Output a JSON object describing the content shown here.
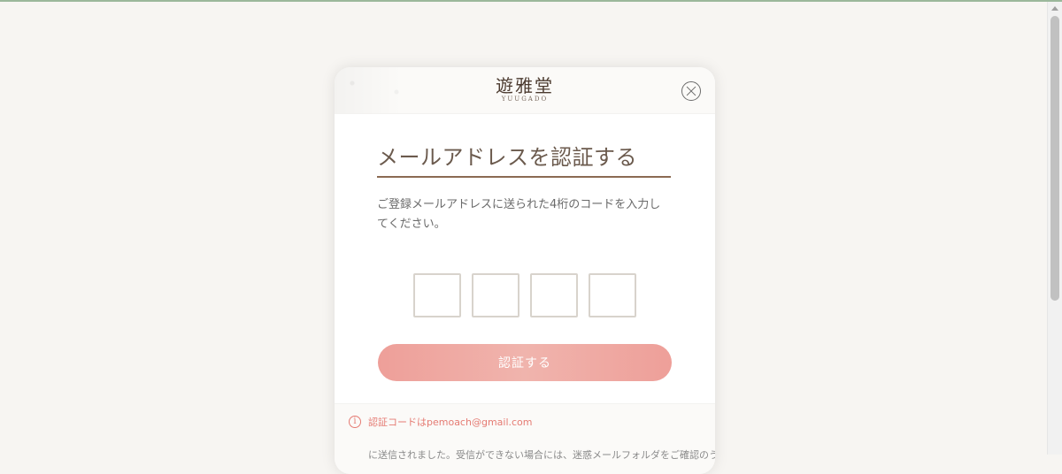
{
  "modal": {
    "logo_main": "遊雅堂",
    "logo_sub": "YUUGADO",
    "title": "メールアドレスを認証する",
    "description": "ご登録メールアドレスに送られた4桁のコードを入力してください。",
    "code_inputs": [
      "",
      "",
      "",
      ""
    ],
    "button_label": "認証する",
    "notice": {
      "line1": "認証コードはpemoach@gmail.com",
      "line2": "に送信されました。受信ができない場合には、迷惑メールフォルダをご確認のう"
    }
  },
  "colors": {
    "page_bg": "#f7f5f2",
    "accent_pink": "#ee9f99",
    "title_underline": "#8b6a52",
    "notice_text": "#e57b73"
  },
  "icons": {
    "close": "close-icon",
    "info": "info-icon",
    "scroll_up": "scroll-up-arrow-icon"
  }
}
